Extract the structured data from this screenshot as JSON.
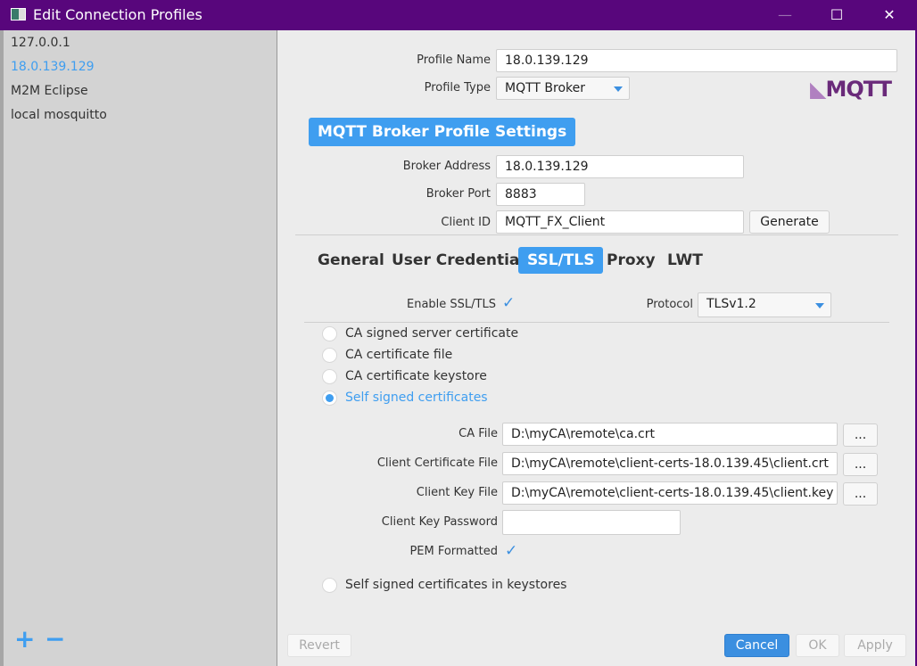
{
  "window": {
    "title": "Edit Connection Profiles",
    "minimize": "—",
    "maximize": "☐",
    "close": "✕"
  },
  "profiles": [
    {
      "label": "127.0.0.1"
    },
    {
      "label": "18.0.139.129",
      "selected": true
    },
    {
      "label": "M2M Eclipse"
    },
    {
      "label": "local mosquitto"
    }
  ],
  "sidebar": {
    "add": "+",
    "remove": "−"
  },
  "profile": {
    "name_label": "Profile Name",
    "name": "18.0.139.129",
    "type_label": "Profile Type",
    "type": "MQTT Broker",
    "logo": "MQTT.org"
  },
  "broker": {
    "heading": "MQTT Broker Profile Settings",
    "address_label": "Broker Address",
    "address": "18.0.139.129",
    "port_label": "Broker Port",
    "port": "8883",
    "client_id_label": "Client ID",
    "client_id": "MQTT_FX_Client",
    "generate": "Generate"
  },
  "tabs": [
    {
      "label": "General"
    },
    {
      "label": "User Credentials"
    },
    {
      "label": "SSL/TLS",
      "active": true
    },
    {
      "label": "Proxy"
    },
    {
      "label": "LWT"
    }
  ],
  "ssl": {
    "enable_label": "Enable SSL/TLS",
    "enabled": true,
    "protocol_label": "Protocol",
    "protocol": "TLSv1.2",
    "options": [
      {
        "label": "CA signed server certificate"
      },
      {
        "label": "CA certificate file"
      },
      {
        "label": "CA certificate keystore"
      },
      {
        "label": "Self signed certificates",
        "selected": true
      }
    ],
    "ca_file_label": "CA File",
    "ca_file": "D:\\myCA\\remote\\ca.crt",
    "client_cert_label": "Client Certificate File",
    "client_cert": "D:\\myCA\\remote\\client-certs-18.0.139.45\\client.crt",
    "client_key_label": "Client Key File",
    "client_key": "D:\\myCA\\remote\\client-certs-18.0.139.45\\client.key",
    "key_password_label": "Client Key Password",
    "key_password": "",
    "pem_label": "PEM Formatted",
    "pem": true,
    "browse": "...",
    "keystores_option": "Self signed certificates in keystores"
  },
  "footer": {
    "revert": "Revert",
    "cancel": "Cancel",
    "ok": "OK",
    "apply": "Apply"
  },
  "colors": {
    "titlebar": "#58067c",
    "accent": "#3f9ef0"
  }
}
